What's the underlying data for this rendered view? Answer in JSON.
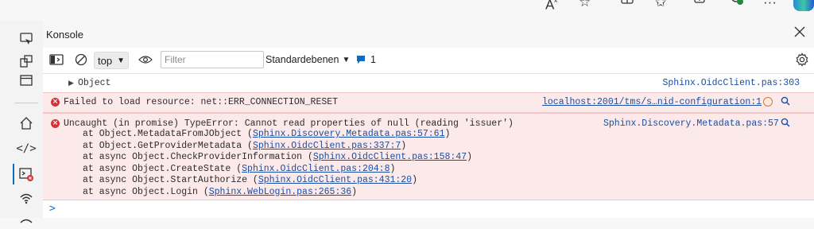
{
  "panel": {
    "title": "Konsole"
  },
  "toolbar": {
    "context": "top",
    "filter_placeholder": "Filter",
    "levels": "Standardebenen",
    "issues_count": "1"
  },
  "messages": {
    "object": {
      "text": "Object",
      "source": "Sphinx.OidcClient.pas:303"
    },
    "error1": {
      "text": "Failed to load resource: net::ERR_CONNECTION_RESET",
      "source": "localhost:2001/tms/s…nid-configuration:1"
    },
    "error2": {
      "text": "Uncaught (in promise) TypeError: Cannot read properties of null (reading 'issuer')",
      "source": "Sphinx.Discovery.Metadata.pas:57",
      "stack": [
        {
          "pre": "at Object.MetadataFromJObject (",
          "link": "Sphinx.Discovery.Metadata.pas:57:61",
          "post": ")"
        },
        {
          "pre": "at Object.GetProviderMetadata (",
          "link": "Sphinx.OidcClient.pas:337:7",
          "post": ")"
        },
        {
          "pre": "at async Object.CheckProviderInformation (",
          "link": "Sphinx.OidcClient.pas:158:47",
          "post": ")"
        },
        {
          "pre": "at async Object.CreateState (",
          "link": "Sphinx.OidcClient.pas:204:8",
          "post": ")"
        },
        {
          "pre": "at async Object.StartAuthorize (",
          "link": "Sphinx.OidcClient.pas:431:20",
          "post": ")"
        },
        {
          "pre": "at async Object.Login (",
          "link": "Sphinx.WebLogin.pas:265:36",
          "post": ")"
        }
      ]
    }
  },
  "prompt": {
    "symbol": ">"
  },
  "colors": {
    "error_bg": "#fce9e9",
    "error_icon": "#d13438",
    "link": "#1a4fa3",
    "accent": "#0f6cbd"
  },
  "icons": [
    "read-aloud-icon",
    "favorite-icon",
    "split-screen-icon",
    "favorites-bar-icon",
    "collections-icon",
    "performance-icon",
    "more-icon",
    "copilot-icon",
    "device-emulation-icon",
    "elements-icon",
    "welcome-icon",
    "home-icon",
    "sources-icon",
    "console-icon",
    "network-icon"
  ]
}
